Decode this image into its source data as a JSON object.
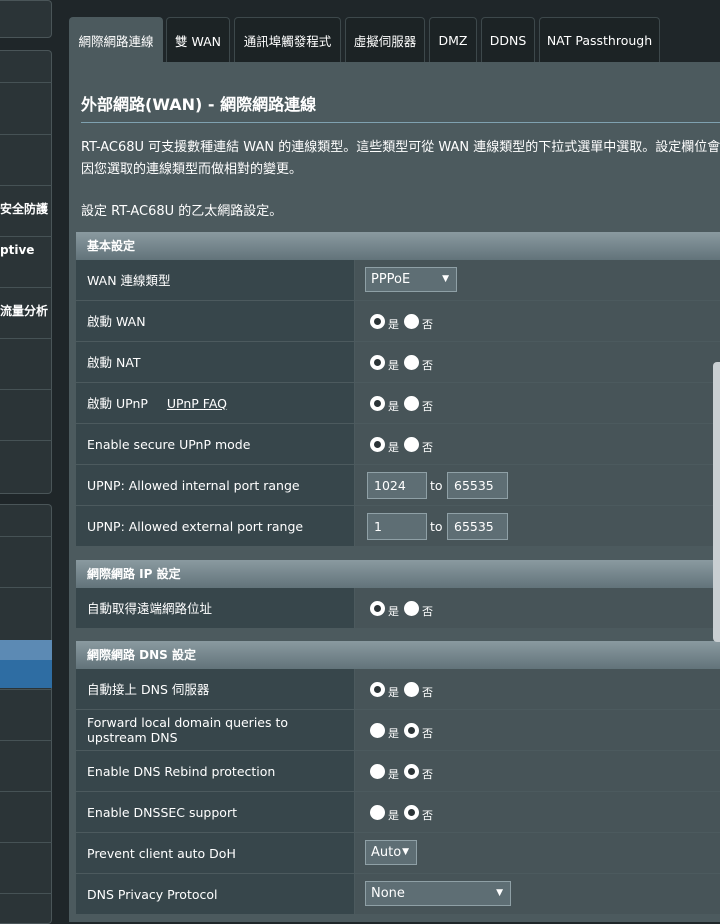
{
  "sidebar": {
    "items": [
      {
        "label": "安全防護"
      },
      {
        "label": "ptive"
      },
      {
        "label": "流量分析"
      }
    ]
  },
  "tabs": [
    {
      "label": "網際網路連線"
    },
    {
      "label": "雙 WAN"
    },
    {
      "label": "通訊埠觸發程式"
    },
    {
      "label": "虛擬伺服器"
    },
    {
      "label": "DMZ"
    },
    {
      "label": "DDNS"
    },
    {
      "label": "NAT Passthrough"
    }
  ],
  "page": {
    "title": "外部網路(WAN) - 網際網路連線",
    "description": "RT-AC68U 可支援數種連結 WAN 的連線類型。這些類型可從 WAN 連線類型的下拉式選單中選取。設定欄位會因您選取的連線類型而做相對的變更。",
    "subtitle": "設定 RT-AC68U 的乙太網路設定。"
  },
  "radio": {
    "yes": "是",
    "no": "否"
  },
  "basic": {
    "heading": "基本設定",
    "wan_type": {
      "label": "WAN 連線類型",
      "value": "PPPoE"
    },
    "enable_wan": {
      "label": "啟動 WAN",
      "selected": "yes"
    },
    "enable_nat": {
      "label": "啟動 NAT",
      "selected": "yes"
    },
    "enable_upnp": {
      "label": "啟動 UPnP",
      "faq": "UPnP FAQ",
      "selected": "yes"
    },
    "secure_upnp": {
      "label": "Enable secure UPnP mode",
      "selected": "yes"
    },
    "internal_range": {
      "label": "UPNP: Allowed internal port range",
      "from": "1024",
      "to_label": "to",
      "to": "65535"
    },
    "external_range": {
      "label": "UPNP: Allowed external port range",
      "from": "1",
      "to_label": "to",
      "to": "65535"
    }
  },
  "ip": {
    "heading": "網際網路 IP 設定",
    "auto_ip": {
      "label": "自動取得遠端網路位址",
      "selected": "yes"
    }
  },
  "dns": {
    "heading": "網際網路 DNS 設定",
    "auto_dns": {
      "label": "自動接上 DNS 伺服器",
      "selected": "yes"
    },
    "forward_local": {
      "label": "Forward local domain queries to upstream DNS",
      "selected": "no"
    },
    "rebind": {
      "label": "Enable DNS Rebind protection",
      "selected": "no"
    },
    "dnssec": {
      "label": "Enable DNSSEC support",
      "selected": "no"
    },
    "auto_doh": {
      "label": "Prevent client auto DoH",
      "value": "Auto"
    },
    "privacy": {
      "label": "DNS Privacy Protocol",
      "value": "None"
    }
  }
}
